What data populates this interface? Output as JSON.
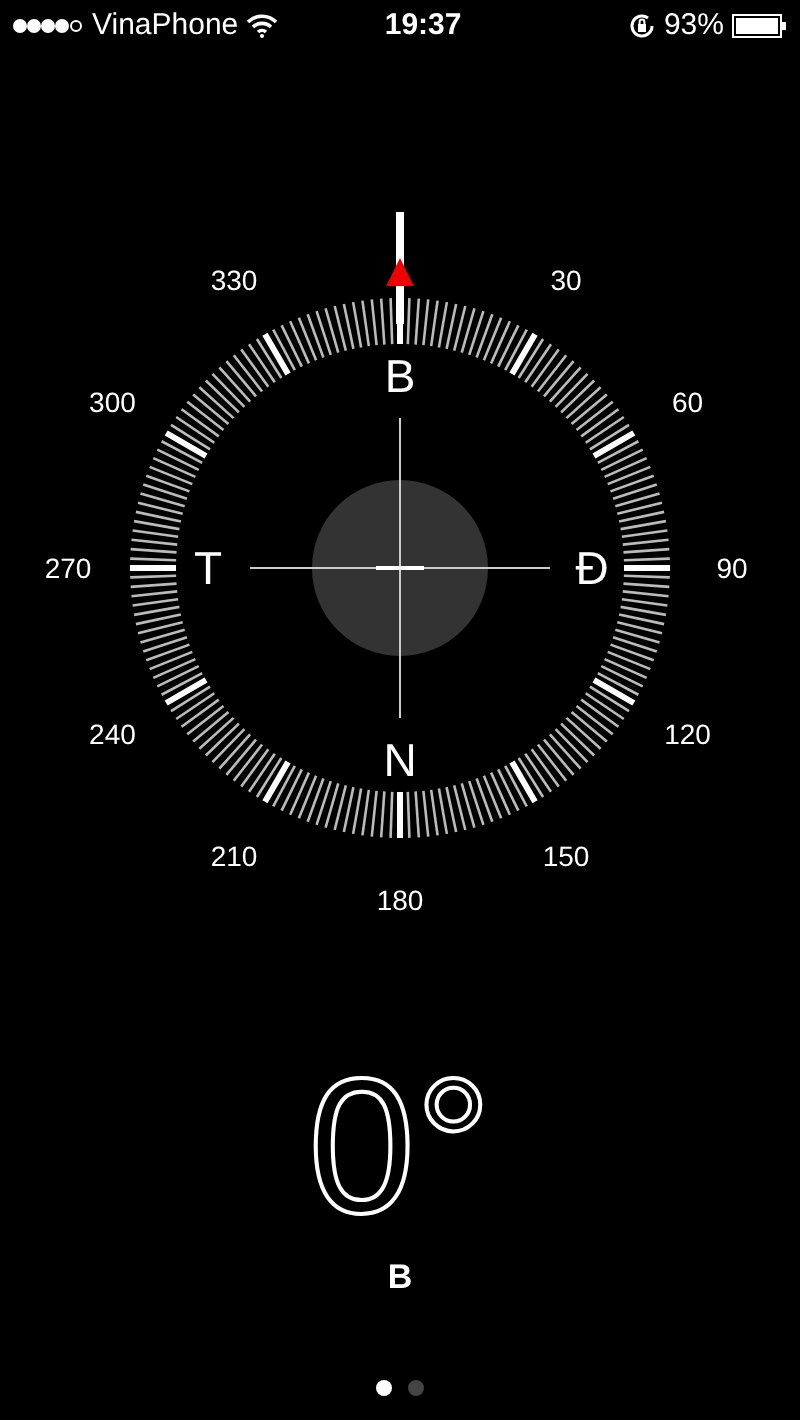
{
  "status_bar": {
    "carrier": "VinaPhone",
    "time": "19:37",
    "battery_percent": "93%"
  },
  "dial": {
    "degree_labels": [
      "30",
      "60",
      "90",
      "120",
      "150",
      "180",
      "210",
      "240",
      "270",
      "300",
      "330"
    ],
    "cardinals": [
      "B",
      "Đ",
      "N",
      "T"
    ]
  },
  "heading": {
    "degrees": "0°",
    "direction": "B"
  },
  "pages": [
    {
      "selected": true
    },
    {
      "selected": false
    }
  ]
}
